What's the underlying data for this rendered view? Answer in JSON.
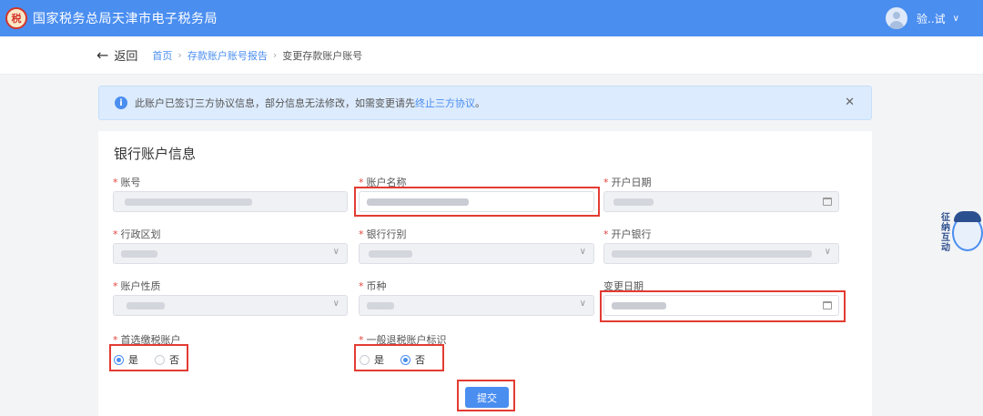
{
  "app": {
    "title": "国家税务总局天津市电子税务局",
    "logo_text": "税"
  },
  "user": {
    "name": "验..试"
  },
  "nav": {
    "back_label": "返回",
    "breadcrumbs": [
      "首页",
      "存款账户账号报告"
    ],
    "current": "变更存款账户账号"
  },
  "notice": {
    "text": "此账户已签订三方协议信息，部分信息无法修改，如需变更请先",
    "link": "终止三方协议",
    "suffix": "。"
  },
  "form": {
    "section_title": "银行账户信息",
    "fields": {
      "account_no": {
        "label": "账号"
      },
      "account_name": {
        "label": "账户名称"
      },
      "open_date": {
        "label": "开户日期"
      },
      "region": {
        "label": "行政区划"
      },
      "bank_type": {
        "label": "银行行别"
      },
      "open_bank": {
        "label": "开户银行"
      },
      "account_nature": {
        "label": "账户性质"
      },
      "currency": {
        "label": "币种"
      },
      "change_date": {
        "label": "变更日期"
      },
      "preferred_account": {
        "label": "首选缴税账户",
        "options": [
          "是",
          "否"
        ],
        "selected": "是"
      },
      "refund_flag": {
        "label": "一般退税账户标识",
        "options": [
          "是",
          "否"
        ],
        "selected": "否"
      }
    },
    "submit_label": "提交"
  },
  "helper": {
    "text": "征纳互动"
  },
  "colors": {
    "primary": "#4a8ef0",
    "highlight": "#e33b32",
    "required": "#e0443d"
  }
}
